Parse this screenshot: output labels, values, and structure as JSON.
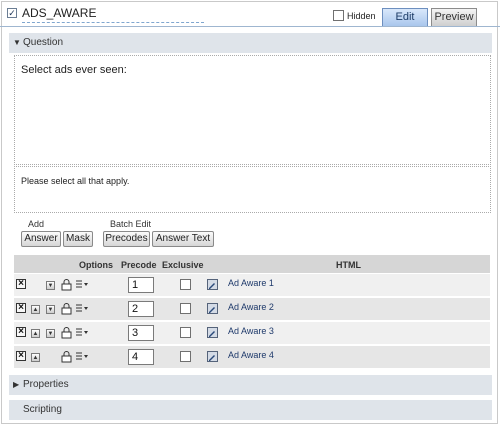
{
  "header": {
    "title": "ADS_AWARE",
    "hidden_label": "Hidden",
    "tabs": {
      "edit": "Edit",
      "preview": "Preview"
    }
  },
  "question": {
    "section_label": "Question",
    "text": "Select ads ever seen:",
    "instruction": "Please select all that apply."
  },
  "add": {
    "label": "Add",
    "answer_button": "Answer",
    "mask_button": "Mask"
  },
  "batch_edit": {
    "label": "Batch Edit",
    "precodes_button": "Precodes",
    "answer_text_button": "Answer Text"
  },
  "table": {
    "headers": {
      "options": "Options",
      "precode": "Precode",
      "exclusive": "Exclusive",
      "html": "HTML"
    },
    "rows": [
      {
        "precode": "1",
        "html": "Ad Aware 1"
      },
      {
        "precode": "2",
        "html": "Ad Aware 2"
      },
      {
        "precode": "3",
        "html": "Ad Aware 3"
      },
      {
        "precode": "4",
        "html": "Ad Aware 4"
      }
    ]
  },
  "sections": {
    "properties": "Properties",
    "scripting": "Scripting"
  }
}
